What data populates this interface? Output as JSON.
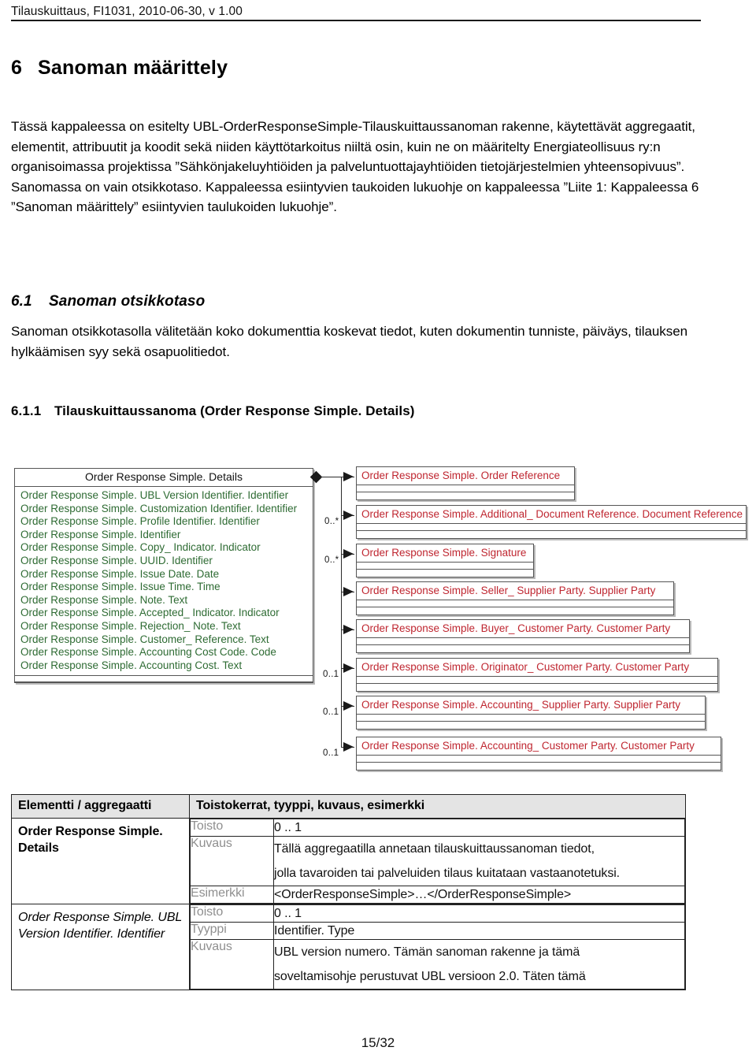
{
  "header": {
    "running_head": "Tilauskuittaus, FI1031, 2010-06-30, v 1.00"
  },
  "headings": {
    "h1_number": "6",
    "h1_title": "Sanoman määrittely",
    "h2_number": "6.1",
    "h2_title": "Sanoman otsikkotaso",
    "h3_number": "6.1.1",
    "h3_title": "Tilauskuittaussanoma (Order Response Simple. Details)"
  },
  "paragraphs": {
    "intro": "Tässä kappaleessa on esitelty UBL-OrderResponseSimple-Tilauskuittaussanoman rakenne, käytettävät aggregaatit, elementit, attribuutit ja koodit sekä niiden käyttötarkoitus niiltä osin, kuin ne on määritelty Energiateollisuus ry:n organisoimassa projektissa ”Sähkönjakeluyhtiöiden ja palveluntuottajayhtiöiden tietojärjestelmien yhteensopivuus”. Sanomassa on vain otsikkotaso. Kappaleessa esiintyvien taukoiden lukuohje on kappaleessa ”Liite 1: Kappaleessa 6 ”Sanoman määrittely” esiintyvien taulukoiden lukuohje”.",
    "section_61": "Sanoman otsikkotasolla välitetään koko dokumenttia koskevat tiedot, kuten dokumentin tunniste, päiväys, tilauksen hylkäämisen syy sekä osapuolitiedot."
  },
  "diagram": {
    "colors": {
      "attribute_text": "#2e6b33",
      "class_title_text": "#bf2630",
      "border": "#555555",
      "shadow": "#b9b9b9"
    },
    "main_class": {
      "title": "Order Response Simple. Details",
      "attributes": [
        "Order Response Simple. UBL Version Identifier. Identifier",
        "Order Response Simple. Customization Identifier. Identifier",
        "Order Response Simple. Profile Identifier. Identifier",
        "Order Response Simple. Identifier",
        "Order Response Simple. Copy_ Indicator. Indicator",
        "Order Response Simple. UUID. Identifier",
        "Order Response Simple. Issue Date. Date",
        "Order Response Simple. Issue Time. Time",
        "Order Response Simple. Note. Text",
        "Order Response Simple. Accepted_ Indicator. Indicator",
        "Order Response Simple. Rejection_ Note. Text",
        "Order Response Simple. Customer_ Reference. Text",
        "Order Response Simple. Accounting Cost Code. Code",
        "Order Response Simple. Accounting Cost. Text"
      ]
    },
    "associations": [
      {
        "title": "Order Response Simple. Order Reference",
        "multiplicity": ""
      },
      {
        "title": "Order Response Simple. Additional_ Document Reference. Document Reference",
        "multiplicity": "0..*"
      },
      {
        "title": "Order Response Simple. Signature",
        "multiplicity": "0..*"
      },
      {
        "title": "Order Response Simple. Seller_ Supplier Party. Supplier Party",
        "multiplicity": ""
      },
      {
        "title": "Order Response Simple. Buyer_ Customer Party. Customer Party",
        "multiplicity": ""
      },
      {
        "title": "Order Response Simple. Originator_ Customer Party. Customer Party",
        "multiplicity": "0..1"
      },
      {
        "title": "Order Response Simple. Accounting_ Supplier Party. Supplier Party",
        "multiplicity": "0..1"
      },
      {
        "title": "Order Response Simple. Accounting_ Customer Party. Customer Party",
        "multiplicity": "0..1"
      }
    ]
  },
  "spec_table": {
    "headers": {
      "col1": "Elementti / aggregaatti",
      "col2": "Toistokerrat, tyyppi, kuvaus, esimerkki"
    },
    "rows": [
      {
        "element_line1": "Order Response Simple.",
        "element_line2": "Details",
        "element_style": "bold",
        "fields": [
          {
            "label": "Toisto",
            "value_lines": [
              "0 ..  1"
            ]
          },
          {
            "label": "Kuvaus",
            "value_lines": [
              "Tällä aggregaatilla annetaan tilauskuittaussanoman tiedot,",
              "jolla tavaroiden tai palveluiden tilaus kuitataan vastaanotetuksi."
            ]
          },
          {
            "label": "Esimerkki",
            "value_lines": [
              "<OrderResponseSimple>…</OrderResponseSimple>"
            ]
          }
        ]
      },
      {
        "element_line1": "Order Response Simple.",
        "element_line2": "UBL Version Identifier.",
        "element_line3": "Identifier",
        "element_style": "italic",
        "fields": [
          {
            "label": "Toisto",
            "value_lines": [
              "0 ..  1"
            ]
          },
          {
            "label": "Tyyppi",
            "value_lines": [
              "Identifier. Type"
            ]
          },
          {
            "label": "Kuvaus",
            "value_lines": [
              "UBL version numero. Tämän sanoman rakenne ja tämä",
              "soveltamisohje perustuvat UBL versioon 2.0. Täten tämä"
            ]
          }
        ]
      }
    ]
  },
  "footer": {
    "page": "15/32"
  }
}
